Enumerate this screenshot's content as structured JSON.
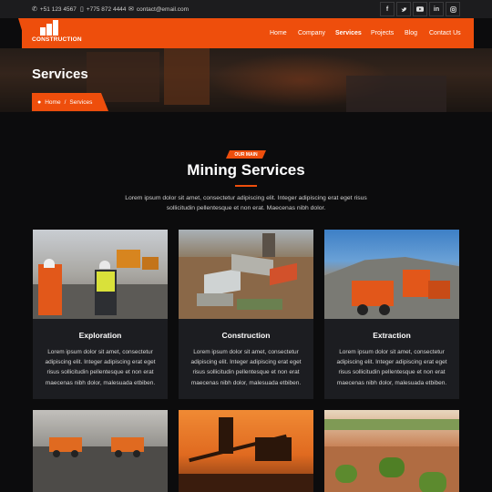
{
  "topbar": {
    "phone1": "+51 123 4567",
    "phone2": "+775 872 4444",
    "email": "contact@email.com",
    "socials": [
      "f",
      "t",
      "yt",
      "in",
      "ig"
    ]
  },
  "brand": {
    "name": "CONSTRUCTION",
    "accent": "#ee4e0c"
  },
  "nav": {
    "items": [
      "Home",
      "Company",
      "Services",
      "Projects",
      "Blog",
      "Contact Us"
    ],
    "active": "Services"
  },
  "hero": {
    "title": "Services",
    "breadcrumb": {
      "home": "Home",
      "sep": "/",
      "current": "Services"
    }
  },
  "section": {
    "kicker": "OUR MAIN",
    "title": "Mining Services",
    "description": "Lorem ipsum dolor sit amet, consectetur adipiscing elit. Integer adipiscing erat eget risus sollicitudin pellentesque et non erat. Maecenas nibh dolor."
  },
  "services": [
    {
      "title": "Exploration",
      "text": "Lorem ipsum dolor sit amet, consectetur adipiscing elit. Integer adipiscing erat eget risus sollicitudin pellentesque et non erat maecenas nibh dolor, malesuada etbiben."
    },
    {
      "title": "Construction",
      "text": "Lorem ipsum dolor sit amet, consectetur adipiscing elit. Integer adipiscing erat eget risus sollicitudin pellentesque et non erat maecenas nibh dolor, malesuada etbiben."
    },
    {
      "title": "Extraction",
      "text": "Lorem ipsum dolor sit amet, consectetur adipiscing elit. Integer adipiscing erat eget risus sollicitudin pellentesque et non erat maecenas nibh dolor, malesuada etbiben."
    }
  ]
}
